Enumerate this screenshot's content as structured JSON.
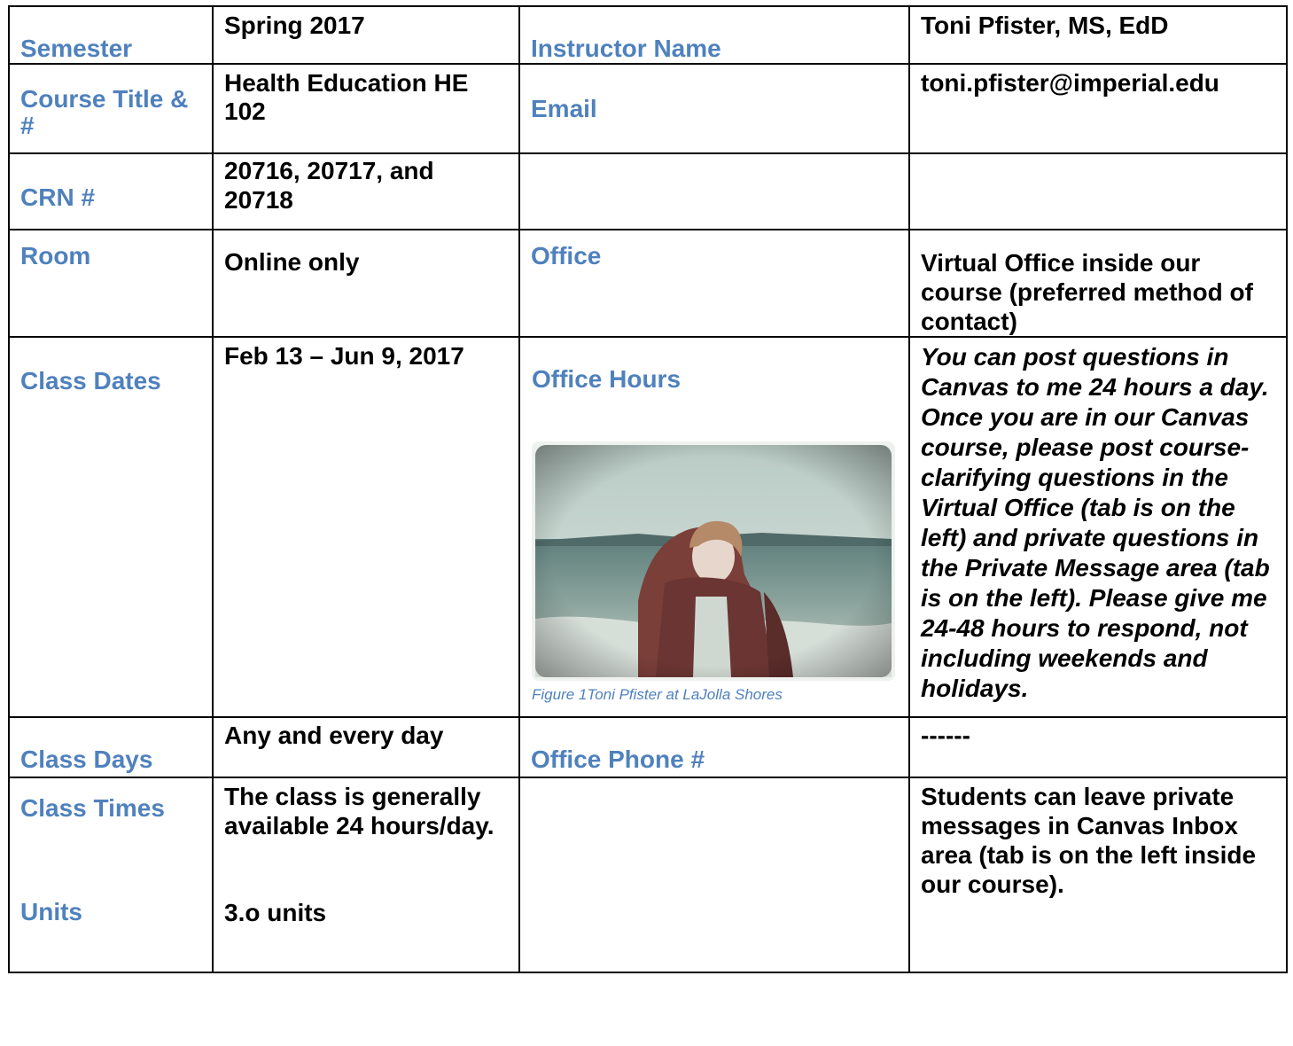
{
  "rows": [
    {
      "label1": "Semester",
      "value1": "Spring 2017",
      "label2": "Instructor Name",
      "value2": "Toni Pfister, MS, EdD"
    },
    {
      "label1": "Course Title & #",
      "value1": "Health Education HE 102",
      "label2": "Email",
      "value2": "toni.pfister@imperial.edu"
    },
    {
      "label1": "CRN #",
      "value1": "20716, 20717, and 20718",
      "label2": "",
      "value2": ""
    },
    {
      "label1": "Room",
      "value1": "Online only",
      "label2": "Office",
      "value2": "Virtual Office inside our course (preferred method of contact)"
    },
    {
      "label1": "Class Dates",
      "value1": "Feb 13 – Jun 9, 2017",
      "label2": "Office Hours",
      "value2": "You can post questions in Canvas to me 24 hours a day.  Once you are in our Canvas course, please post course-clarifying questions in the Virtual Office (tab is on the left) and private questions in the Private Message area (tab is on the left).  Please give me 24-48 hours to respond, not including weekends and holidays."
    },
    {
      "label1": "Class Days",
      "value1": "Any and every day",
      "label2": "Office Phone #",
      "value2": "------"
    },
    {
      "label1": "Class Times",
      "value1": "The class is generally available 24 hours/day.",
      "label1b": "Units",
      "value1b": "3.o units",
      "label2": "",
      "value2": "Students can leave private messages in Canvas Inbox area (tab is on the left inside our course)."
    }
  ],
  "figure": {
    "caption": "Figure 1Toni Pfister at LaJolla Shores"
  }
}
